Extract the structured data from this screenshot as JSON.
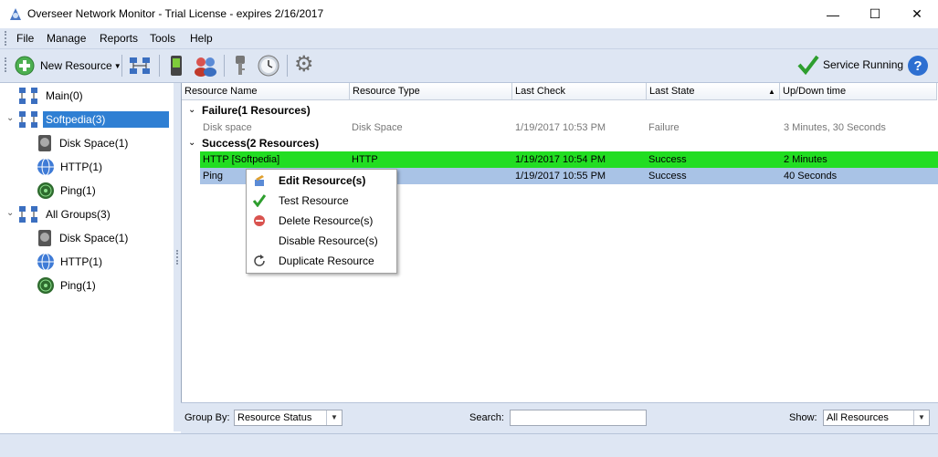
{
  "window": {
    "title": "Overseer Network Monitor - Trial License - expires 2/16/2017",
    "controls": {
      "minimize": "—",
      "maximize": "☐",
      "close": "✕"
    }
  },
  "menu": {
    "items": [
      "File",
      "Manage",
      "Reports",
      "Tools",
      "Help"
    ]
  },
  "toolbar": {
    "new_resource_label": "New Resource",
    "service_status": "Service Running",
    "icons": [
      "network-groups-icon",
      "phone-icon",
      "users-icon",
      "key-icon",
      "clock-icon",
      "settings-gear-icon"
    ]
  },
  "tree": {
    "nodes": [
      {
        "label": "Main(0)"
      },
      {
        "label": "Softpedia(3)",
        "selected": true
      },
      {
        "label": "Disk Space(1)"
      },
      {
        "label": "HTTP(1)"
      },
      {
        "label": "Ping(1)"
      },
      {
        "label": "All Groups(3)"
      },
      {
        "label": "Disk Space(1)"
      },
      {
        "label": "HTTP(1)"
      },
      {
        "label": "Ping(1)"
      }
    ]
  },
  "grid": {
    "columns": [
      "Resource Name",
      "Resource Type",
      "Last Check",
      "Last State",
      "Up/Down time"
    ],
    "groups": [
      {
        "header": "Failure(1 Resources)",
        "rows": [
          {
            "name": "Disk space",
            "type": "Disk Space",
            "last_check": "1/19/2017 10:53 PM",
            "state": "Failure",
            "uptime": "3 Minutes, 30 Seconds"
          }
        ]
      },
      {
        "header": "Success(2 Resources)",
        "rows": [
          {
            "name": "HTTP [Softpedia]",
            "type": "HTTP",
            "last_check": "1/19/2017 10:54 PM",
            "state": "Success",
            "uptime": "2 Minutes"
          },
          {
            "name": "Ping",
            "type": "",
            "last_check": "1/19/2017 10:55 PM",
            "state": "Success",
            "uptime": "40 Seconds"
          }
        ]
      }
    ]
  },
  "context_menu": {
    "items": [
      "Edit Resource(s)",
      "Test Resource",
      "Delete Resource(s)",
      "Disable Resource(s)",
      "Duplicate Resource"
    ]
  },
  "bottom": {
    "group_by_label": "Group By:",
    "group_by_value": "Resource Status",
    "search_label": "Search:",
    "search_value": "",
    "show_label": "Show:",
    "show_value": "All Resources"
  },
  "colors": {
    "selection": "#2f7fd3",
    "success_row": "#22dd22",
    "selected_row": "#a9c3e6",
    "chrome": "#dee6f3"
  }
}
